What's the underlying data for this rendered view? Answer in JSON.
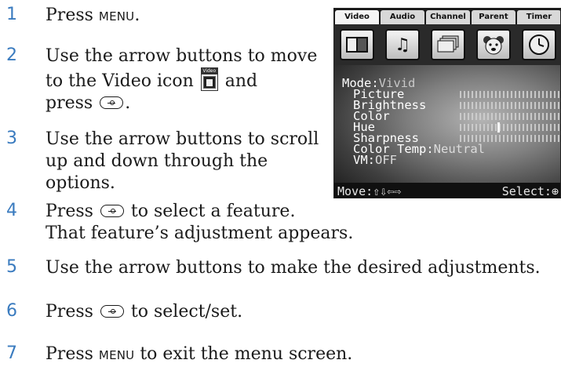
{
  "steps": [
    {
      "n": "1",
      "a": "Press ",
      "b": "MENU",
      "c": "."
    },
    {
      "n": "2",
      "line1": "Use the arrow buttons to move",
      "line2a": "to the Video icon ",
      "line2b": " and",
      "line3a": "press ",
      "line3b": "."
    },
    {
      "n": "3",
      "line1": "Use the arrow buttons to scroll",
      "line2": "up and down through the",
      "line3": "options."
    },
    {
      "n": "4",
      "line1a": "Press ",
      "line1b": " to select a feature.",
      "line2": "That feature’s adjustment appears."
    },
    {
      "n": "5",
      "text": "Use the arrow buttons to make the desired adjustments."
    },
    {
      "n": "6",
      "a": "Press ",
      "b": " to select/set."
    },
    {
      "n": "7",
      "a": "Press ",
      "b": "MENU",
      "c": " to exit the menu screen."
    }
  ],
  "inline_icon": {
    "label": "Video",
    "name": "video-menu-icon"
  },
  "tv_menu": {
    "tabs": [
      "Video",
      "Audio",
      "Channel",
      "Parent",
      "Timer"
    ],
    "active_tab": "Video",
    "icons": [
      "video-icon",
      "audio-icon",
      "channel-icon",
      "parent-icon",
      "timer-icon"
    ],
    "mode_label": "Mode:",
    "mode_value": "Vivid",
    "items": [
      "Picture",
      "Brightness",
      "Color",
      "Hue",
      "Sharpness"
    ],
    "color_temp_label": "Color Temp:",
    "color_temp_value": "Neutral",
    "vm_label": "VM:",
    "vm_value": "OFF",
    "footer_move": "Move:",
    "footer_move_arrows": "⇧⇩⇦⇨",
    "footer_select": "Select:",
    "footer_select_symbol": "⊕"
  }
}
